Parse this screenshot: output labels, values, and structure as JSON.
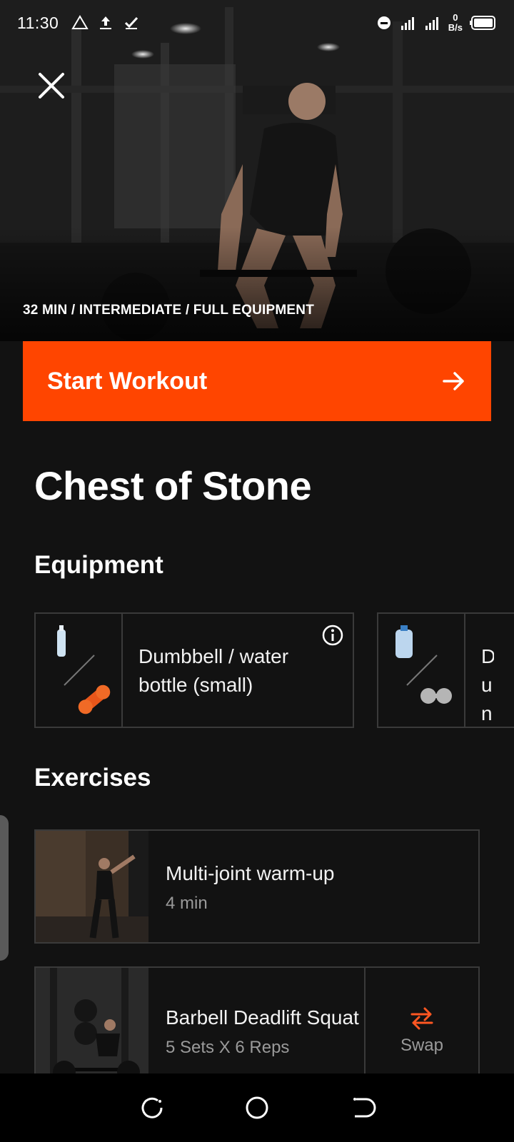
{
  "status_bar": {
    "time": "11:30",
    "net_speed_top": "0",
    "net_speed_unit": "B/s",
    "network": "4G"
  },
  "hero": {
    "meta": "32 MIN / INTERMEDIATE / FULL EQUIPMENT"
  },
  "start_button": {
    "label": "Start Workout"
  },
  "workout": {
    "title": "Chest of Stone"
  },
  "equipment": {
    "heading": "Equipment",
    "items": [
      {
        "label": "Dumbbell / water bottle (small)"
      },
      {
        "label": "Dumbbell / water bottle (large)",
        "visible_label": "Dun bott"
      }
    ]
  },
  "exercises": {
    "heading": "Exercises",
    "items": [
      {
        "name": "Multi-joint warm-up",
        "detail": "4 min"
      },
      {
        "name": "Barbell Deadlift Squat",
        "detail": "5 Sets X 6 Reps",
        "action": "Swap"
      }
    ]
  },
  "colors": {
    "accent": "#ff4500",
    "background": "#121212",
    "border": "#3a3a3a",
    "muted_text": "#9a9a9a"
  },
  "icons": {
    "close": "close-icon",
    "arrow": "arrow-right-icon",
    "info": "info-icon",
    "swap": "swap-icon"
  }
}
